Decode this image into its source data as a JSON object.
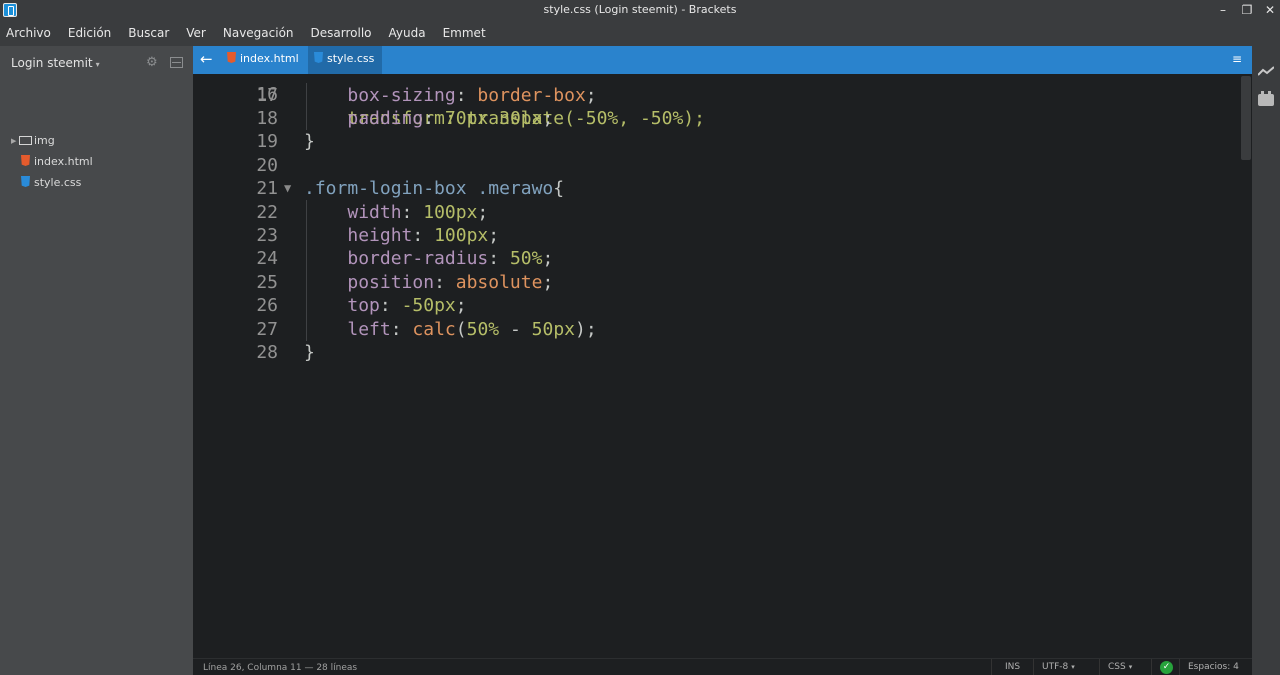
{
  "window": {
    "title": "style.css (Login steemit) - Brackets",
    "min_glyph": "–",
    "max_glyph": "❐",
    "close_glyph": "✕"
  },
  "menu": [
    "Archivo",
    "Edición",
    "Buscar",
    "Ver",
    "Navegación",
    "Desarrollo",
    "Ayuda",
    "Emmet"
  ],
  "sidebar": {
    "project_name": "Login steemit",
    "caret": "▾",
    "settings_glyph": "⚙",
    "tree": {
      "folder_label": "img",
      "files": [
        "index.html",
        "style.css"
      ]
    }
  },
  "tabs": {
    "back_glyph": "←",
    "items": [
      "index.html",
      "style.css"
    ],
    "active": "style.css",
    "menu_glyph": "≡"
  },
  "editor": {
    "partial_line_number": "16",
    "partial_line_text": "    transform: translate(-50%, -50%);",
    "lines": [
      {
        "n": "17",
        "text": "    box-sizing: border-box;"
      },
      {
        "n": "18",
        "text": "    padding: 70px 30px;"
      },
      {
        "n": "19",
        "text": "}"
      },
      {
        "n": "20",
        "text": ""
      },
      {
        "n": "21",
        "text": ".form-login-box .merawo{",
        "fold": "▼"
      },
      {
        "n": "22",
        "text": "    width: 100px;"
      },
      {
        "n": "23",
        "text": "    height: 100px;"
      },
      {
        "n": "24",
        "text": "    border-radius: 50%;"
      },
      {
        "n": "25",
        "text": "    position: absolute;"
      },
      {
        "n": "26",
        "text": "    top: -50px;"
      },
      {
        "n": "27",
        "text": "    left: calc(50% - 50px);"
      },
      {
        "n": "28",
        "text": "}"
      }
    ]
  },
  "statusbar": {
    "position": "Línea 26, Columna 11 — 28 líneas",
    "mode": "INS",
    "encoding": "UTF-8",
    "language": "CSS",
    "lint_glyph": "✓",
    "spaces": "Espacios: 4",
    "caret": "▾"
  },
  "colors": {
    "accent": "#2a83cd",
    "property": "#b294bb",
    "number": "#b5bd68",
    "keyword": "#de935f",
    "selector": "#81a2be",
    "lint_ok": "#27a33c"
  }
}
